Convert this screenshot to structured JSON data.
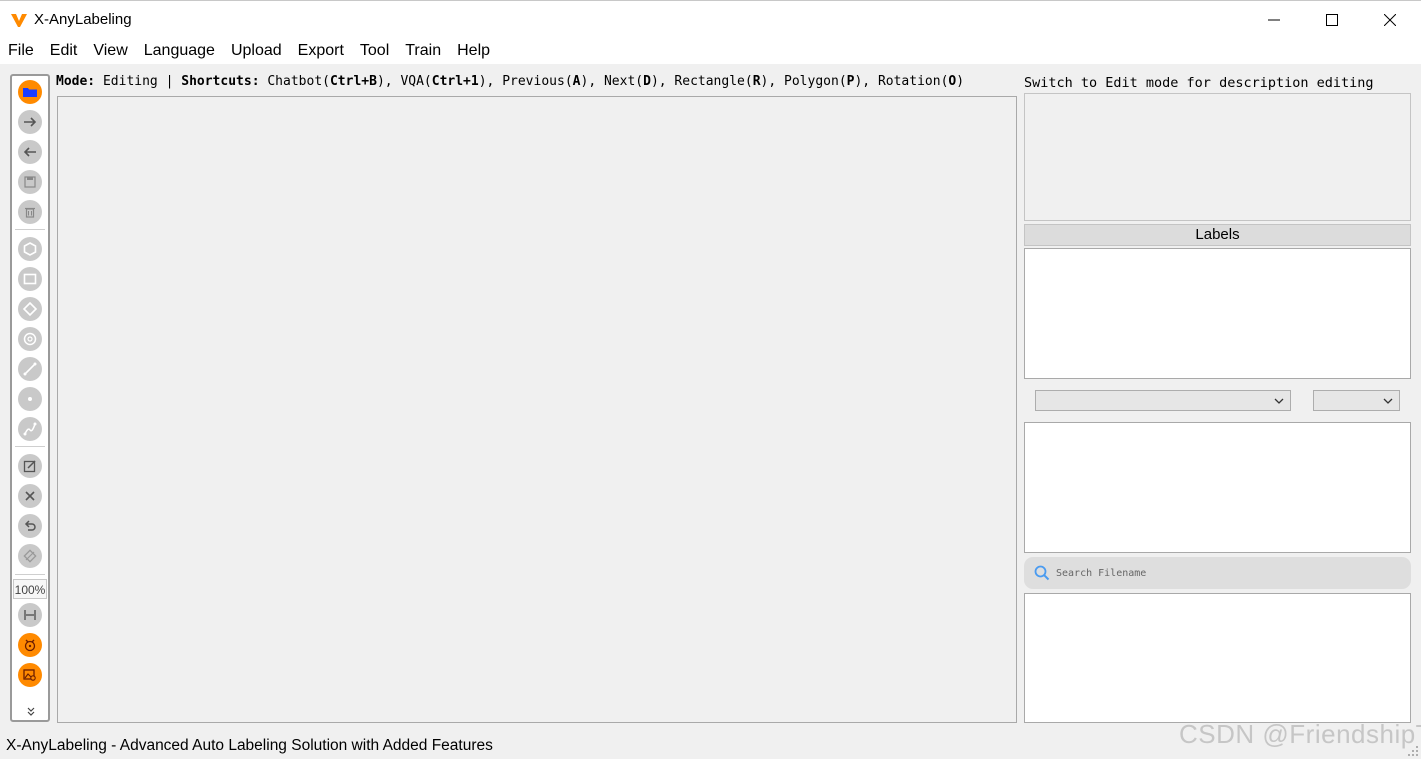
{
  "window": {
    "title": "X-AnyLabeling",
    "accent_color": "#ff8a00"
  },
  "menu": {
    "items": [
      "File",
      "Edit",
      "View",
      "Language",
      "Upload",
      "Export",
      "Tool",
      "Train",
      "Help"
    ]
  },
  "toolbar": {
    "icons": [
      "open-folder-icon",
      "next-arrow-icon",
      "previous-arrow-icon",
      "save-icon",
      "delete-file-icon",
      "polygon-icon",
      "rectangle-icon",
      "rotation-icon",
      "circle-icon",
      "line-icon",
      "point-icon",
      "linestrip-icon",
      "edit-icon",
      "delete-icon",
      "undo-icon",
      "brightness-icon",
      "fit-width-icon",
      "auto-labeling-icon",
      "image-search-icon"
    ],
    "zoom": "100%"
  },
  "mode_line": {
    "mode_label": "Mode:",
    "mode_value": "Editing",
    "separator": "|",
    "shortcuts_label": "Shortcuts:",
    "shortcuts": [
      {
        "name": "Chatbot",
        "key": "Ctrl+B"
      },
      {
        "name": "VQA",
        "key": "Ctrl+1"
      },
      {
        "name": "Previous",
        "key": "A"
      },
      {
        "name": "Next",
        "key": "D"
      },
      {
        "name": "Rectangle",
        "key": "R"
      },
      {
        "name": "Polygon",
        "key": "P"
      },
      {
        "name": "Rotation",
        "key": "O"
      }
    ]
  },
  "right_panel": {
    "description_hint": "Switch to Edit mode for description editing",
    "labels_header": "Labels",
    "search": {
      "placeholder": "Search Filename"
    }
  },
  "status_bar": {
    "text": "X-AnyLabeling - Advanced Auto Labeling Solution with Added Features"
  },
  "watermark": "CSDN @FriendshipT"
}
